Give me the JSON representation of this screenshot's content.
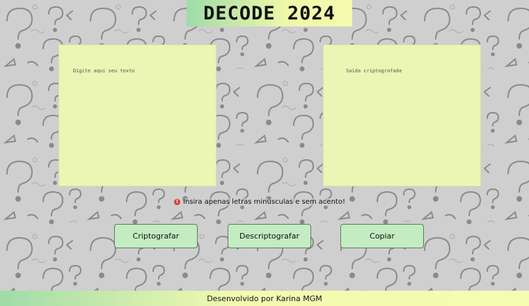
{
  "header": {
    "title": "DECODE 2024"
  },
  "input_panel": {
    "placeholder": "Digite aqui seu texto"
  },
  "output_panel": {
    "placeholder": "Saída criptografada"
  },
  "warning": {
    "icon": "warning-icon",
    "text": "Insira apenas letras minúsculas e sem acento!"
  },
  "buttons": {
    "encrypt": "Criptografar",
    "decrypt": "Descriptografar",
    "copy": "Copiar"
  },
  "footer": {
    "text": "Desenvolvido por Karina MGM"
  },
  "background": {
    "pattern": "question-mark-doodles",
    "color": "#cfcfcf"
  },
  "colors": {
    "panel": "#ebf5b4",
    "button": "#c4ecc2",
    "accent_green": "#9fdca8",
    "accent_yellow": "#f5fbb0",
    "warning_red": "#d9413a"
  }
}
